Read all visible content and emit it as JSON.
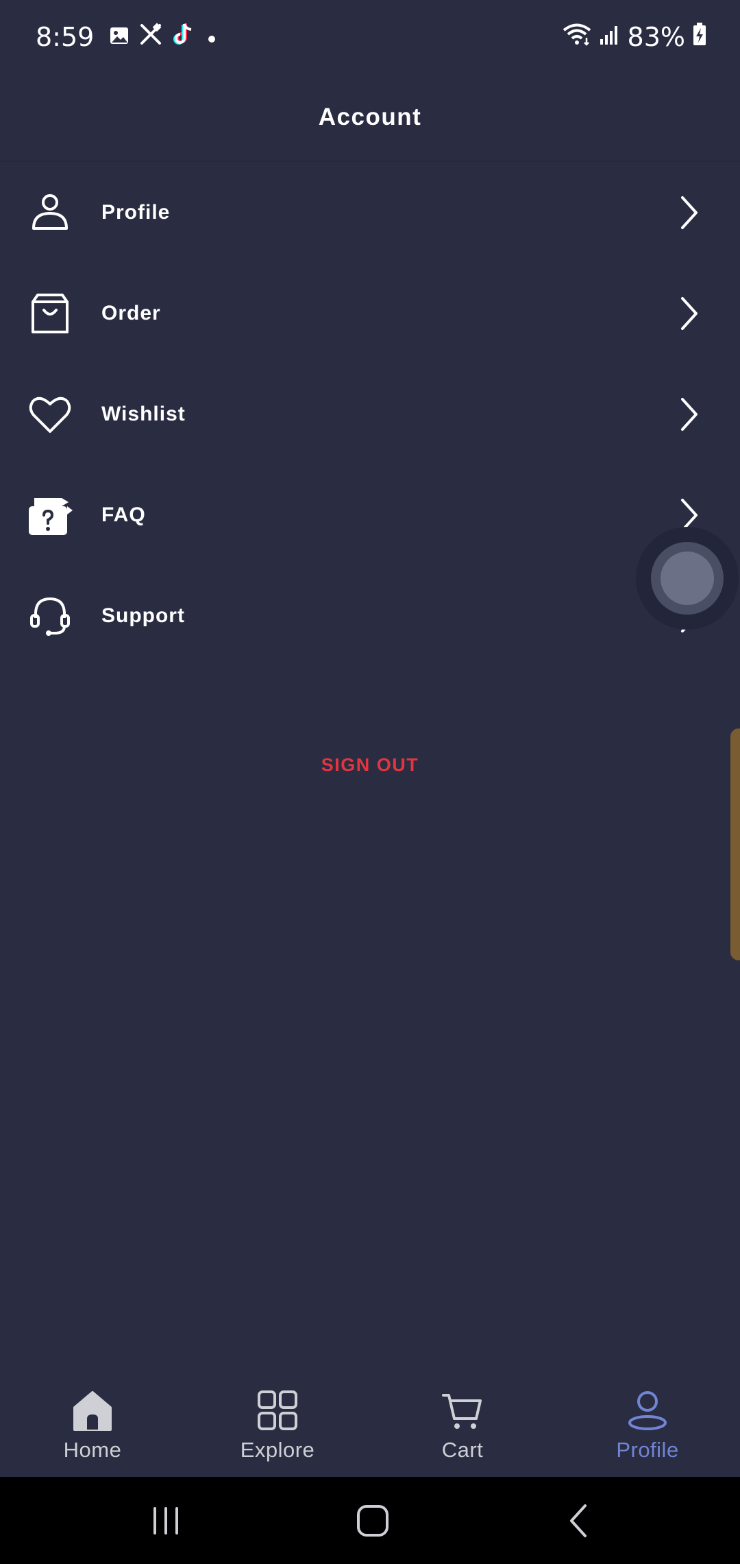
{
  "status_bar": {
    "time": "8:59",
    "battery": "83%",
    "notification_icons": [
      "gallery-icon",
      "tools-icon",
      "tiktok-icon",
      "dot-icon"
    ],
    "system_icons": [
      "wifi-icon",
      "signal-icon",
      "battery-charging-icon"
    ]
  },
  "header": {
    "title": "Account"
  },
  "menu": {
    "items": [
      {
        "label": "Profile",
        "icon": "person-icon"
      },
      {
        "label": "Order",
        "icon": "bag-icon"
      },
      {
        "label": "Wishlist",
        "icon": "heart-icon"
      },
      {
        "label": "FAQ",
        "icon": "faq-icon"
      },
      {
        "label": "Support",
        "icon": "headset-icon"
      }
    ]
  },
  "sign_out_label": "SIGN OUT",
  "bottom_nav": {
    "items": [
      {
        "label": "Home",
        "icon": "home-icon"
      },
      {
        "label": "Explore",
        "icon": "grid-icon"
      },
      {
        "label": "Cart",
        "icon": "cart-icon"
      },
      {
        "label": "Profile",
        "icon": "profile-icon",
        "active": true
      }
    ]
  },
  "colors": {
    "background": "#2a2d41",
    "sign_out": "#e2353f",
    "nav_active": "#7184d6",
    "nav_inactive": "#cfd0d6"
  }
}
